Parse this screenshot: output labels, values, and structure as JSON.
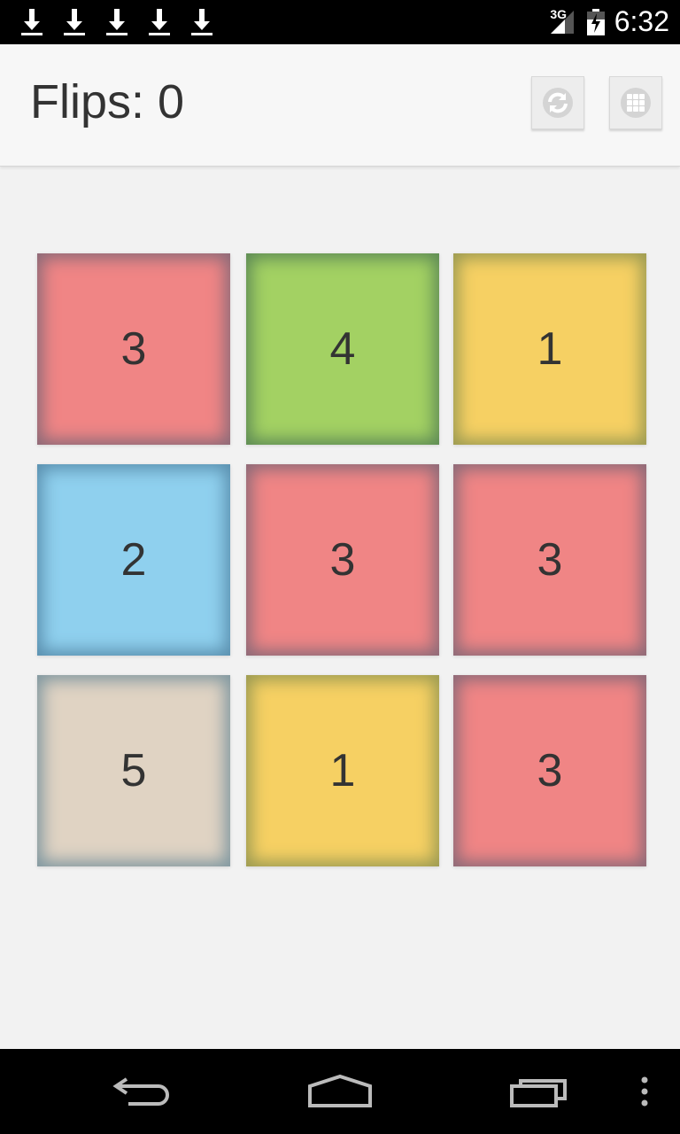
{
  "status_bar": {
    "notifications": [
      "download-icon",
      "download-icon",
      "download-icon",
      "download-icon",
      "download-icon"
    ],
    "network": "3G",
    "time": "6:32"
  },
  "app_bar": {
    "flips_text": "Flips: 0",
    "actions": [
      {
        "name": "reset-button",
        "icon": "refresh-icon"
      },
      {
        "name": "grid-menu-button",
        "icon": "grid-icon"
      }
    ]
  },
  "board": {
    "rows": 3,
    "cols": 3,
    "tiles": [
      {
        "label": "3",
        "color": "#f08585",
        "edge": "#8a6a78"
      },
      {
        "label": "4",
        "color": "#a3d163",
        "edge": "#5d8a55"
      },
      {
        "label": "1",
        "color": "#f6d063",
        "edge": "#9a9a52"
      },
      {
        "label": "2",
        "color": "#8fd0ee",
        "edge": "#5a8fae"
      },
      {
        "label": "3",
        "color": "#f08585",
        "edge": "#8a6a78"
      },
      {
        "label": "3",
        "color": "#f08585",
        "edge": "#8a6a78"
      },
      {
        "label": "5",
        "color": "#e0d3c3",
        "edge": "#7f97a0"
      },
      {
        "label": "1",
        "color": "#f6d063",
        "edge": "#9a9a52"
      },
      {
        "label": "3",
        "color": "#f08585",
        "edge": "#8a6a78"
      }
    ]
  },
  "nav_bar": {
    "buttons": [
      "back-icon",
      "home-icon",
      "recent-apps-icon",
      "overflow-menu-icon"
    ]
  }
}
